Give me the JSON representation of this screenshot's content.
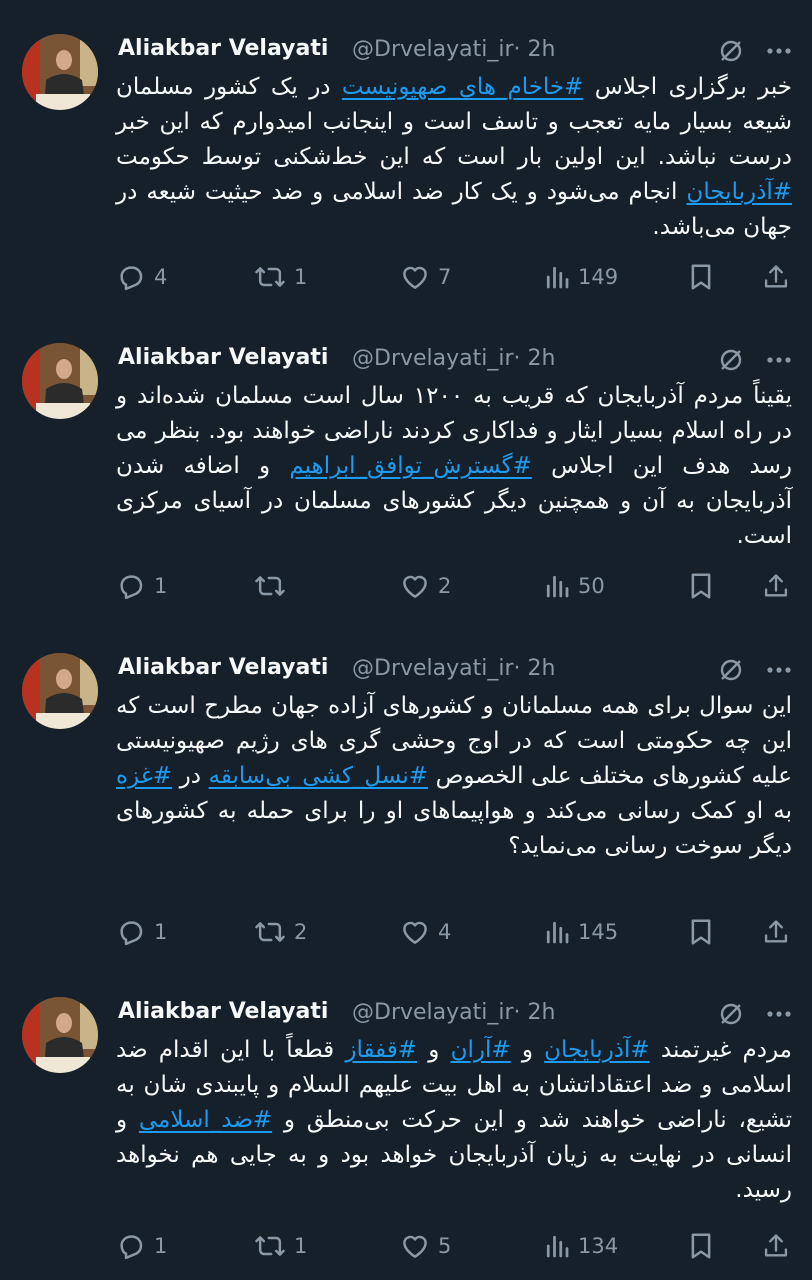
{
  "colors": {
    "background": "#15202b",
    "text": "#f7f9f9",
    "secondary": "#8b98a5",
    "link": "#1d9bf0"
  },
  "icons": {
    "reply": "reply-icon",
    "retweet": "retweet-icon",
    "like": "heart-icon",
    "views": "views-icon",
    "bookmark": "bookmark-icon",
    "share": "share-icon",
    "grok": "grok-icon",
    "more": "more-icon"
  },
  "tweets": [
    {
      "author": "Aliakbar Velayati",
      "handle": "@Drvelayati_ir",
      "time": "· 2h",
      "segments": [
        {
          "text": "خبر برگزاری اجلاس ",
          "tag": false
        },
        {
          "text": "#خاخام_های_صهیونیست",
          "tag": true
        },
        {
          "text": " در یک کشور مسلمان شیعه بسیار مایه تعجب و تاسف است و اینجانب امیدوارم که این خبر درست نباشد. این اولین بار است که این خط‌شکنی توسط حکومت ",
          "tag": false
        },
        {
          "text": "#آذربایجان",
          "tag": true
        },
        {
          "text": " انجام می‌شود و یک کار ضد اسلامی و ضد حیثیت شیعه در جهان می‌باشد.",
          "tag": false
        }
      ],
      "replies": "4",
      "retweets": "1",
      "likes": "7",
      "views": "149"
    },
    {
      "author": "Aliakbar Velayati",
      "handle": "@Drvelayati_ir",
      "time": "· 2h",
      "segments": [
        {
          "text": "یقیناً مردم آذربایجان که قریب به ۱۲۰۰ سال است مسلمان شده‌اند و در راه اسلام بسیار ایثار و فداکاری کردند ناراضی خواهند بود. بنظر می رسد هدف این اجلاس ",
          "tag": false
        },
        {
          "text": "#گسترش_توافق_ابراهیم",
          "tag": true
        },
        {
          "text": " و اضافه شدن آذربایجان به آن و همچنین دیگر کشورهای مسلمان در آسیای مرکزی است.",
          "tag": false
        }
      ],
      "replies": "1",
      "retweets": "",
      "likes": "2",
      "views": "50"
    },
    {
      "author": "Aliakbar Velayati",
      "handle": "@Drvelayati_ir",
      "time": "· 2h",
      "segments": [
        {
          "text": "این سوال برای همه مسلمانان و کشورهای آزاده جهان مطرح است که این چه حکومتی است که در اوج وحشی گری های رژیم صهیونیستی علیه کشورهای مختلف علی الخصوص ",
          "tag": false
        },
        {
          "text": "#نسل_کشی_بی‌سابقه",
          "tag": true
        },
        {
          "text": " در ",
          "tag": false
        },
        {
          "text": "#غزه",
          "tag": true
        },
        {
          "text": " به او کمک رسانی می‌کند و هواپیماهای او را برای حمله به کشورهای دیگر سوخت رسانی می‌نماید؟",
          "tag": false
        }
      ],
      "replies": "1",
      "retweets": "2",
      "likes": "4",
      "views": "145"
    },
    {
      "author": "Aliakbar Velayati",
      "handle": "@Drvelayati_ir",
      "time": "· 2h",
      "segments": [
        {
          "text": "مردم غیرتمند ",
          "tag": false
        },
        {
          "text": "#آذربایجان",
          "tag": true
        },
        {
          "text": " و ",
          "tag": false
        },
        {
          "text": "#آران",
          "tag": true
        },
        {
          "text": " و ",
          "tag": false
        },
        {
          "text": "#قفقاز",
          "tag": true
        },
        {
          "text": " قطعاً با این اقدام ضد اسلامی و ضد اعتقاداتشان به اهل بیت علیهم السلام و پایبندی شان به تشیع، ناراضی خواهند شد و این حرکت بی‌منطق و ",
          "tag": false
        },
        {
          "text": "#ضد_اسلامی",
          "tag": true
        },
        {
          "text": " و انسانی در نهایت به زیان آذربایجان خواهد بود و به جایی هم نخواهد رسید.",
          "tag": false
        }
      ],
      "replies": "1",
      "retweets": "1",
      "likes": "5",
      "views": "134"
    }
  ]
}
